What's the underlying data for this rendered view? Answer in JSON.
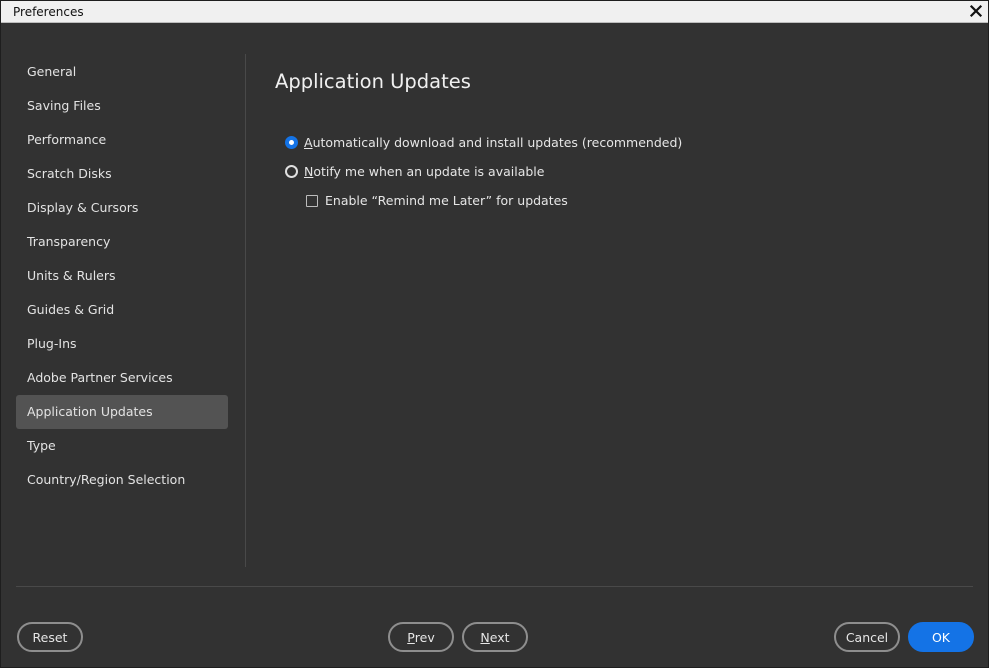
{
  "window": {
    "title": "Preferences"
  },
  "sidebar": {
    "items": [
      {
        "label": "General"
      },
      {
        "label": "Saving Files"
      },
      {
        "label": "Performance"
      },
      {
        "label": "Scratch Disks"
      },
      {
        "label": "Display & Cursors"
      },
      {
        "label": "Transparency"
      },
      {
        "label": "Units & Rulers"
      },
      {
        "label": "Guides & Grid"
      },
      {
        "label": "Plug-Ins"
      },
      {
        "label": "Adobe Partner Services"
      },
      {
        "label": "Application Updates",
        "selected": true
      },
      {
        "label": "Type"
      },
      {
        "label": "Country/Region Selection"
      }
    ]
  },
  "main": {
    "title": "Application Updates",
    "options": {
      "auto_install": {
        "mnemonic": "A",
        "rest": "utomatically download and install updates (recommended)",
        "checked": true
      },
      "notify": {
        "mnemonic": "N",
        "rest": "otify me when an update is available",
        "checked": false
      },
      "remind_later": {
        "label": "Enable “Remind me Later” for updates",
        "checked": false
      }
    }
  },
  "footer": {
    "reset_label": "Reset",
    "prev_mnemonic": "P",
    "prev_rest": "rev",
    "next_mnemonic": "N",
    "next_rest": "ext",
    "cancel_label": "Cancel",
    "ok_label": "OK"
  },
  "colors": {
    "background": "#323232",
    "selected_item": "#535353",
    "accent": "#1473e6"
  }
}
